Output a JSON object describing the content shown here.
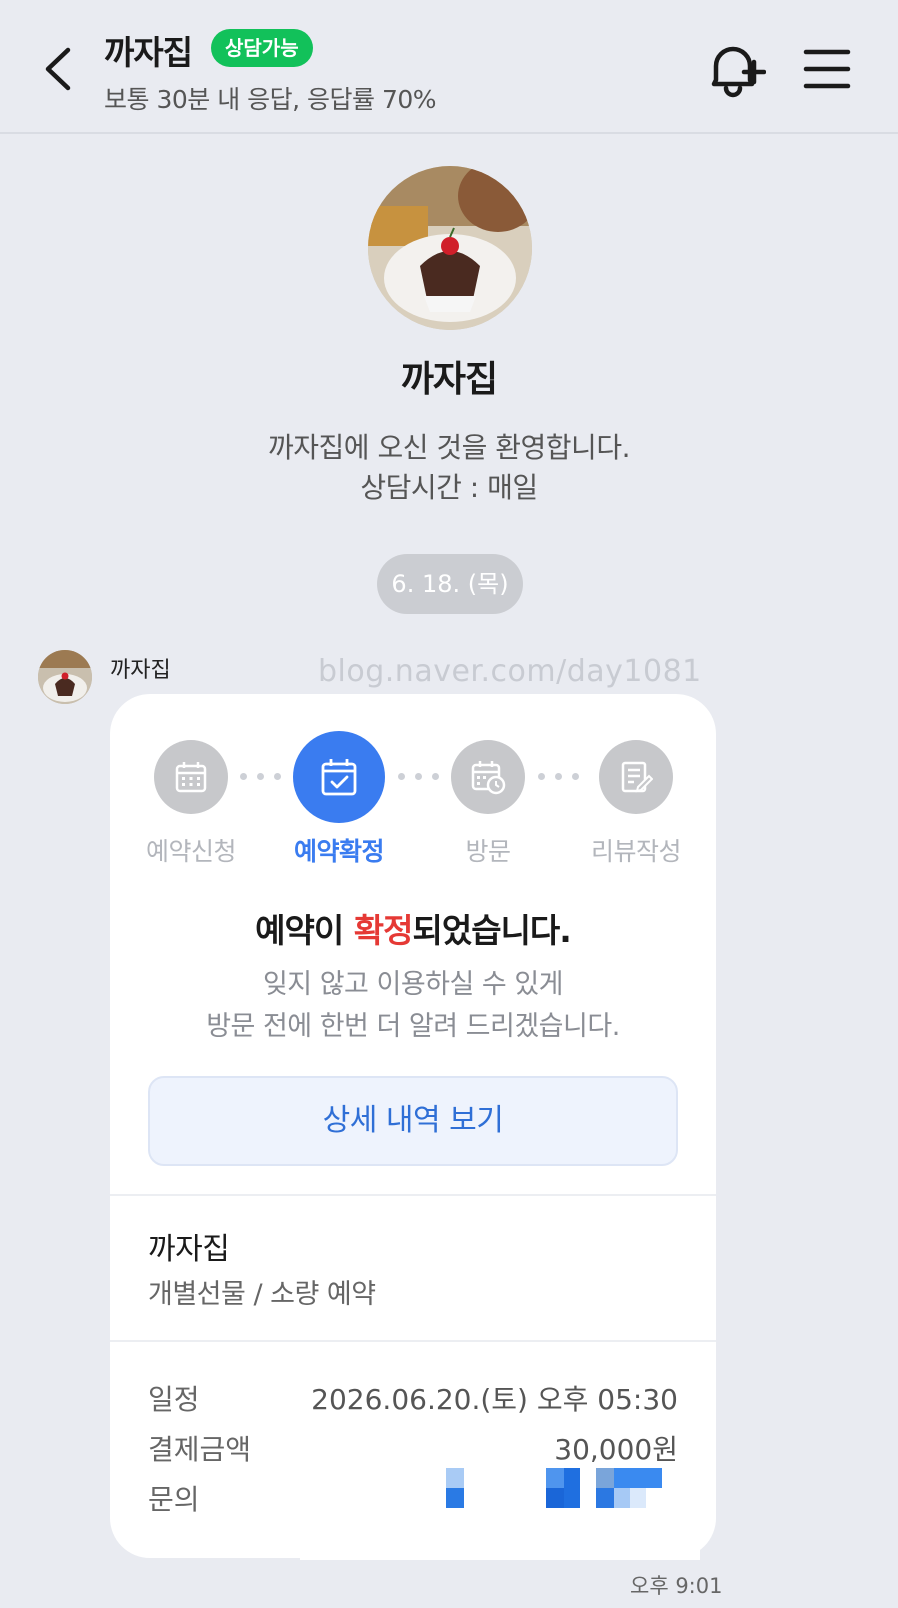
{
  "header": {
    "title": "까자집",
    "status_badge": "상담가능",
    "subtitle": "보통 30분 내 응답, 응답률 70%"
  },
  "profile": {
    "name": "까자집",
    "welcome_line1": "까자집에 오신 것을 환영합니다.",
    "welcome_line2": "상담시간 : 매일"
  },
  "chat": {
    "date": "6. 18. (목)",
    "sender_name": "까자집",
    "watermark": "blog.naver.com/day1081",
    "time": "오후 9:01"
  },
  "card": {
    "steps": [
      {
        "label": "예약신청",
        "icon": "calendar-icon",
        "active": false
      },
      {
        "label": "예약확정",
        "icon": "calendar-check-icon",
        "active": true
      },
      {
        "label": "방문",
        "icon": "calendar-clock-icon",
        "active": false
      },
      {
        "label": "리뷰작성",
        "icon": "edit-note-icon",
        "active": false
      }
    ],
    "title_before": "예약이 ",
    "title_highlight": "확정",
    "title_after": "되었습니다.",
    "desc_line1": "잊지 않고 이용하실 수 있게",
    "desc_line2": "방문 전에 한번 더 알려 드리겠습니다.",
    "detail_button": "상세 내역 보기",
    "shop_name": "까자집",
    "shop_type": "개별선물 / 소량 예약",
    "info": [
      {
        "key": "일정",
        "value": "2026.06.20.(토) 오후 05:30"
      },
      {
        "key": "결제금액",
        "value": "30,000원"
      },
      {
        "key": "문의",
        "value": ""
      }
    ]
  },
  "colors": {
    "background": "#e9ebf1",
    "badge": "#12c15a",
    "accent": "#3a7cf0",
    "highlight": "#e53935"
  }
}
